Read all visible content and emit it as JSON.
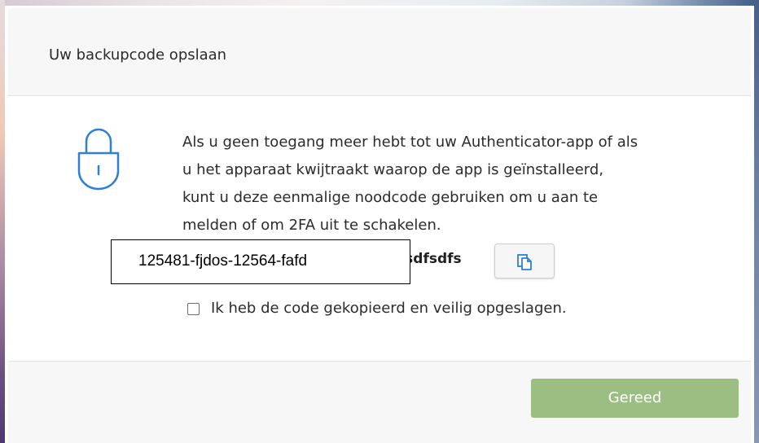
{
  "dialog": {
    "title": "Uw backupcode opslaan",
    "lock_icon": "lock-icon",
    "message_lines": [
      "Als u geen toegang meer hebt tot uw Authenticator-app of als",
      "u het apparaat kwijtraakt waarop de app is geïnstalleerd,",
      "kunt u deze eenmalige noodcode gebruiken om u aan te",
      "melden of om 2FA uit te schakelen."
    ],
    "backup_code_visible": "-ssdfsdfs",
    "copy_icon": "copy-icon",
    "overlay_code": "125481-fjdos-12564-fafd",
    "checkbox": {
      "checked": false,
      "label": "Ik heb de code gekopieerd en veilig opgeslagen."
    },
    "done_button_label": "Gereed"
  },
  "colors": {
    "accent_blue": "#2f7fd6",
    "done_button_green": "#9bbf82",
    "header_background": "#f7f7f7"
  }
}
